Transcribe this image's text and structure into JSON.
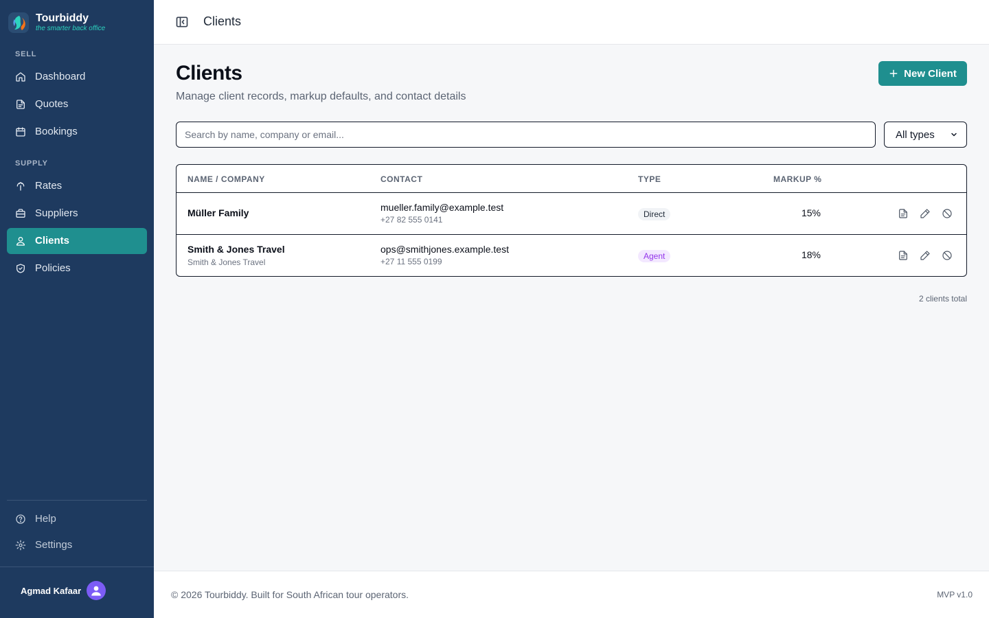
{
  "brand": {
    "name": "Tourbiddy",
    "tagline": "the smarter back office"
  },
  "sidebar": {
    "sections": [
      {
        "label": "SELL",
        "items": [
          {
            "label": "Dashboard",
            "icon": "home-icon"
          },
          {
            "label": "Quotes",
            "icon": "document-icon"
          },
          {
            "label": "Bookings",
            "icon": "calendar-icon"
          }
        ]
      },
      {
        "label": "SUPPLY",
        "items": [
          {
            "label": "Rates",
            "icon": "rates-icon"
          },
          {
            "label": "Suppliers",
            "icon": "briefcase-icon"
          },
          {
            "label": "Clients",
            "icon": "users-icon",
            "active": true
          },
          {
            "label": "Policies",
            "icon": "shield-icon"
          }
        ]
      }
    ],
    "bottom": [
      {
        "label": "Help",
        "icon": "help-icon"
      },
      {
        "label": "Settings",
        "icon": "gear-icon"
      }
    ],
    "user": {
      "name": "Agmad Kafaar"
    }
  },
  "topbar": {
    "title": "Clients"
  },
  "page": {
    "title": "Clients",
    "subtitle": "Manage client records, markup defaults, and contact details",
    "new_button": "New Client",
    "search_placeholder": "Search by name, company or email...",
    "type_filter": {
      "selected": "All types"
    }
  },
  "table": {
    "headers": [
      "NAME / COMPANY",
      "CONTACT",
      "TYPE",
      "MARKUP %"
    ],
    "rows": [
      {
        "name": "Müller Family",
        "company": "",
        "email": "mueller.family@example.test",
        "phone": "+27 82 555 0141",
        "type": "Direct",
        "markup": "15%"
      },
      {
        "name": "Smith & Jones Travel",
        "company": "Smith & Jones Travel",
        "email": "ops@smithjones.example.test",
        "phone": "+27 11 555 0199",
        "type": "Agent",
        "markup": "18%"
      }
    ],
    "total": "2 clients total"
  },
  "footer": {
    "copyright": "© 2026 Tourbiddy. Built for South African tour operators.",
    "version": "MVP v1.0"
  },
  "colors": {
    "sidebar_bg": "#1e3a5f",
    "accent": "#1f8f8f",
    "agent_badge": "#9333ea",
    "avatar": "#7c5cf6"
  }
}
